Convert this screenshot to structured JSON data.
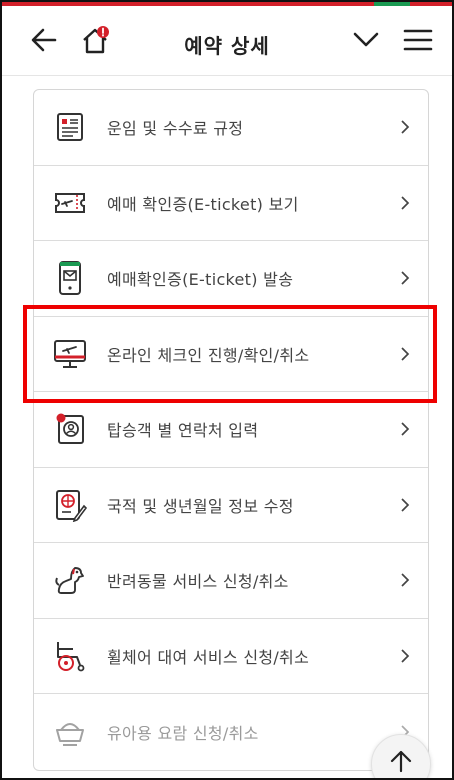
{
  "header": {
    "title": "예약 상세",
    "back_icon": "arrow-left-icon",
    "home_icon": "home-icon",
    "dropdown_icon": "chevron-down-icon",
    "menu_icon": "hamburger-menu-icon"
  },
  "colors": {
    "accent_red": "#d3202a",
    "accent_green": "#1a9a52",
    "highlight": "#ee0000"
  },
  "menu_items": [
    {
      "label": "운임 및 수수료 규정",
      "icon": "fare-rules-document-icon"
    },
    {
      "label": "예매 확인증(E-ticket) 보기",
      "icon": "ticket-icon"
    },
    {
      "label": "예매확인증(E-ticket) 발송",
      "icon": "mobile-mail-icon"
    },
    {
      "label": "온라인 체크인 진행/확인/취소",
      "icon": "monitor-plane-icon",
      "highlighted": true
    },
    {
      "label": "탑승객 별 연락처 입력",
      "icon": "passenger-contact-icon"
    },
    {
      "label": "국적 및 생년월일 정보 수정",
      "icon": "passport-edit-icon"
    },
    {
      "label": "반려동물 서비스 신청/취소",
      "icon": "pet-dog-icon"
    },
    {
      "label": "휠체어 대여 서비스 신청/취소",
      "icon": "wheelchair-icon"
    },
    {
      "label": "유아용 요람 신청/취소",
      "icon": "baby-bassinet-icon"
    }
  ],
  "scroll_top_icon": "arrow-up-icon"
}
